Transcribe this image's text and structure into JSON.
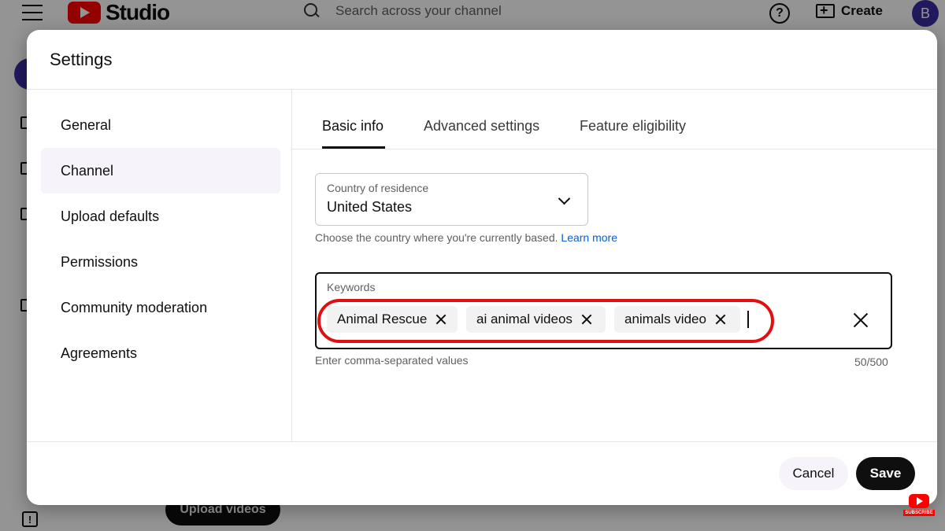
{
  "app": {
    "logo_text": "Studio",
    "search_placeholder": "Search across your channel",
    "help_glyph": "?",
    "create_label": "Create",
    "avatar_initial": "B",
    "upload_videos_label": "Upload videos",
    "report_glyph": "!"
  },
  "dialog": {
    "title": "Settings",
    "nav_items": [
      {
        "label": "General",
        "active": false
      },
      {
        "label": "Channel",
        "active": true
      },
      {
        "label": "Upload defaults",
        "active": false
      },
      {
        "label": "Permissions",
        "active": false
      },
      {
        "label": "Community moderation",
        "active": false
      },
      {
        "label": "Agreements",
        "active": false
      }
    ],
    "tabs": [
      {
        "label": "Basic info",
        "active": true
      },
      {
        "label": "Advanced settings",
        "active": false
      },
      {
        "label": "Feature eligibility",
        "active": false
      }
    ],
    "country": {
      "label": "Country of residence",
      "value": "United States",
      "help_text": "Choose the country where you're currently based.",
      "learn_more": "Learn more"
    },
    "keywords": {
      "label": "Keywords",
      "chips": [
        "Animal Rescue",
        "ai animal videos",
        "animals video"
      ],
      "help_text": "Enter comma-separated values",
      "count": "50/500"
    },
    "footer": {
      "cancel_label": "Cancel",
      "save_label": "Save"
    }
  },
  "badge": {
    "subscribe_text": "SUBSCRIBE"
  },
  "colors": {
    "brand_red": "#ff0000",
    "highlight_red": "#e01010",
    "link_blue": "#065fd4",
    "avatar_purple": "#3a2ca0"
  }
}
